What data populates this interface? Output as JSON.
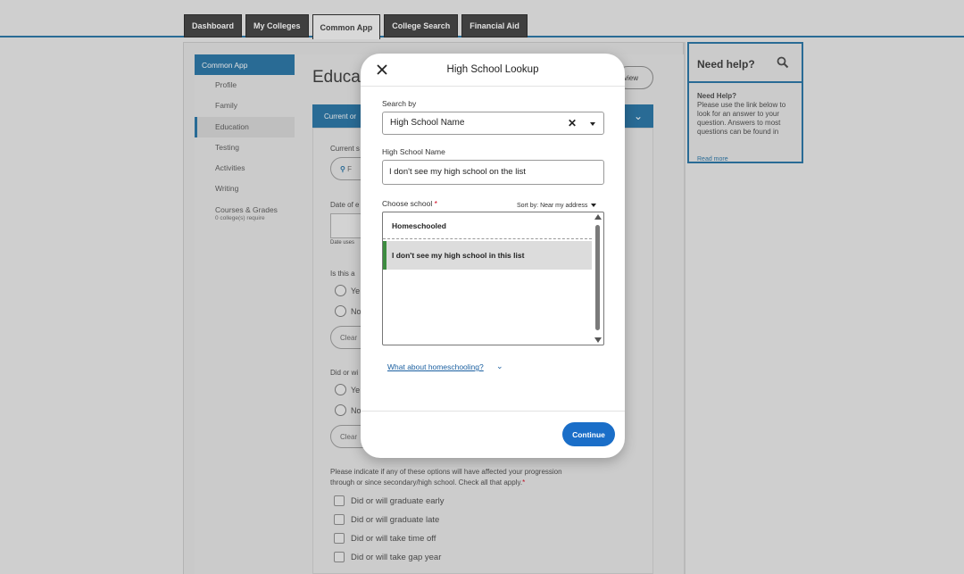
{
  "tabs": [
    "Dashboard",
    "My Colleges",
    "Common App",
    "College Search",
    "Financial Aid"
  ],
  "sidebar": {
    "header": "Common App",
    "items": [
      "Profile",
      "Family",
      "Education",
      "Testing",
      "Activities",
      "Writing",
      "Courses & Grades"
    ],
    "courses_sub": "0 college(s) require"
  },
  "main": {
    "heading": "Educat",
    "preview": "view",
    "section_bar": "Current or",
    "current_label": "Current s",
    "find_pill": "F",
    "date_label": "Date of e",
    "date_hint": "Date uses",
    "is_this_label": "Is this a",
    "yes": "Ye",
    "no": "No",
    "clear": "Clear",
    "did_or_label": "Did or wi",
    "progression_text_1": "Please indicate if any of these options will have affected your progression",
    "progression_text_2": "through or since secondary/high school. Check all that apply.",
    "checkboxes": [
      "Did or will graduate early",
      "Did or will graduate late",
      "Did or will take time off",
      "Did or will take gap year"
    ]
  },
  "help": {
    "title": "Need help?",
    "body_title": "Need Help?",
    "body": "Please use the link below to look for an answer to your question. Answers to most questions can be found in",
    "link": "Read more"
  },
  "modal": {
    "title": "High School Lookup",
    "search_by_label": "Search by",
    "search_by_value": "High School Name",
    "name_label": "High School Name",
    "name_value": "I don't see my high school on the list",
    "choose_label": "Choose school",
    "required_mark": "*",
    "sort_label": "Sort by: Near my address",
    "options": [
      "Homeschooled",
      "I don't see my high school in this list"
    ],
    "homeschool_link": "What about homeschooling?",
    "continue": "Continue"
  },
  "colors": {
    "accent": "#1f6fa3",
    "continue": "#1a6ec8",
    "selected_marker": "#3d8c40"
  }
}
